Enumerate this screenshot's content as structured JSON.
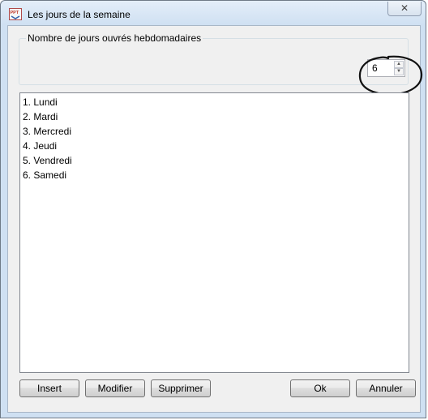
{
  "window": {
    "title": "Les jours de la semaine",
    "app_icon": "ppt-app-icon",
    "close_glyph": "✕"
  },
  "group": {
    "label": "Nombre de jours ouvrés hebdomadaires"
  },
  "spinner": {
    "value": "6",
    "up_glyph": "▲",
    "down_glyph": "▼"
  },
  "days": [
    "1. Lundi",
    "2. Mardi",
    "3. Mercredi",
    "4. Jeudi",
    "5. Vendredi",
    "6. Samedi"
  ],
  "buttons": {
    "insert": "Insert",
    "modifier": "Modifier",
    "supprimer": "Supprimer",
    "ok": "Ok",
    "annuler": "Annuler"
  },
  "colors": {
    "title_bar": "#cfe0f2",
    "client_bg": "#f0f0f0",
    "annotation_circle": "#111111"
  }
}
